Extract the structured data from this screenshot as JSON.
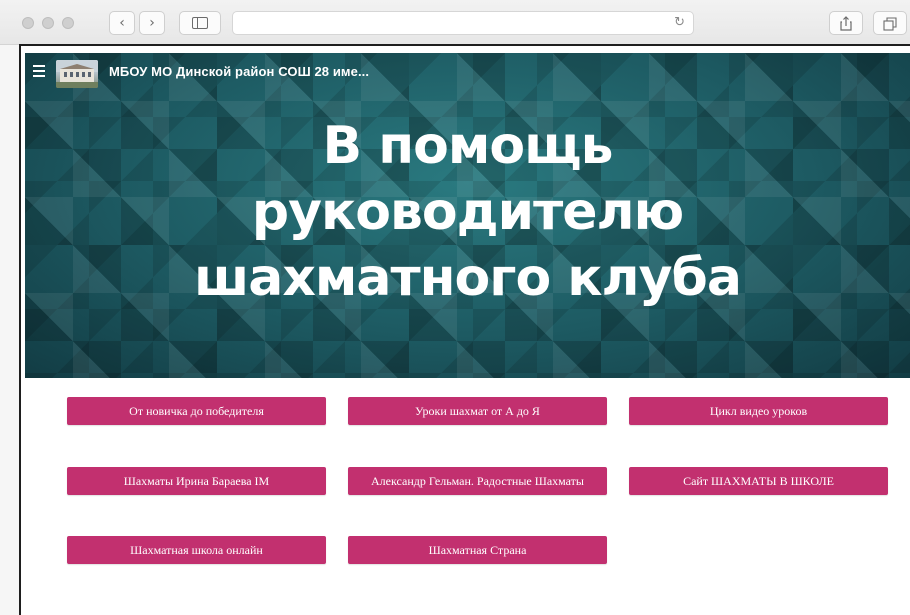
{
  "site": {
    "title": "МБОУ МО Динской район СОШ 28 име..."
  },
  "hero": {
    "title_lines": [
      "В помощь",
      "руководителю",
      "шахматного клуба"
    ]
  },
  "buttons": [
    {
      "label": "От новичка до победителя"
    },
    {
      "label": "Уроки шахмат от А до Я"
    },
    {
      "label": "Цикл видео уроков"
    },
    {
      "label": "Шахматы Ирина Бараева IM"
    },
    {
      "label": "Александр Гельман. Радостные Шахматы"
    },
    {
      "label": "Сайт ШАХМАТЫ В ШКОЛЕ"
    },
    {
      "label": "Шахматная школа онлайн"
    },
    {
      "label": "Шахматная Страна"
    }
  ],
  "icons": {
    "back": "chevron-left-icon",
    "forward": "chevron-right-icon",
    "sidebar": "sidebar-icon",
    "reload": "reload-icon",
    "share": "share-icon",
    "tabs": "tabs-icon",
    "menu": "hamburger-menu-icon"
  },
  "colors": {
    "button": "#c2306f",
    "hero_base": "#1f5e66"
  }
}
